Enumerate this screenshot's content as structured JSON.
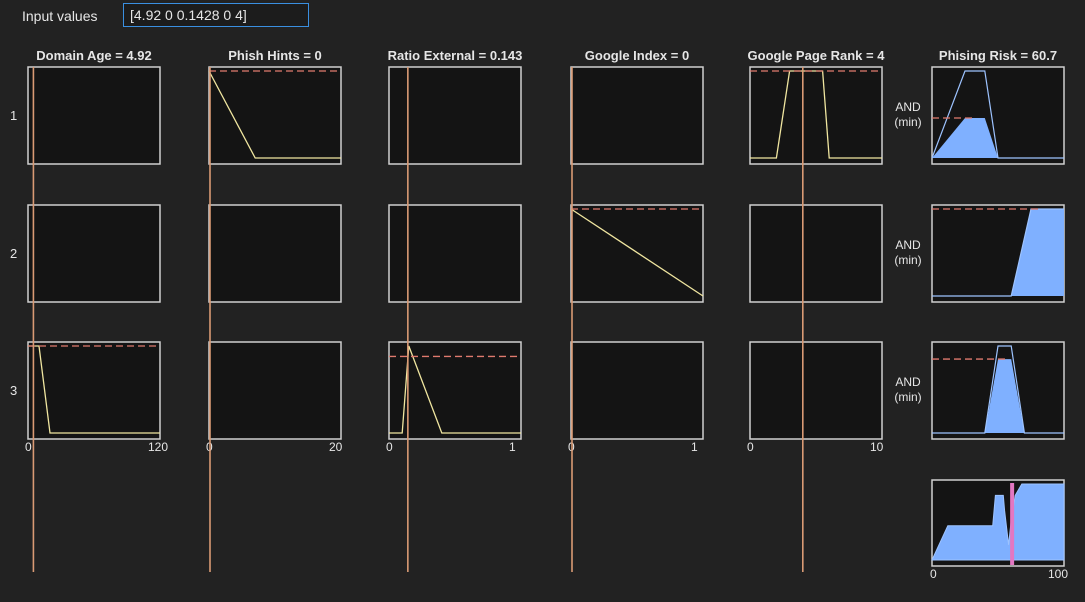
{
  "input": {
    "label": "Input values",
    "value": "[4.92 0 0.1428 0 4]"
  },
  "columns": [
    {
      "title": "Domain Age = 4.92",
      "xmin": 0,
      "xmax": 120,
      "tick_min": "0",
      "tick_max": "120",
      "input": 4.92
    },
    {
      "title": "Phish Hints = 0",
      "xmin": 0,
      "xmax": 20,
      "tick_min": "0",
      "tick_max": "20",
      "input": 0
    },
    {
      "title": "Ratio External = 0.143",
      "xmin": 0,
      "xmax": 1,
      "tick_min": "0",
      "tick_max": "1",
      "input": 0.1428
    },
    {
      "title": "Google Index = 0",
      "xmin": 0,
      "xmax": 1,
      "tick_min": "0",
      "tick_max": "1",
      "input": 0
    },
    {
      "title": "Google Page Rank = 4",
      "xmin": 0,
      "xmax": 10,
      "tick_min": "0",
      "tick_max": "10",
      "input": 4
    }
  ],
  "output": {
    "title": "Phising Risk = 60.7",
    "tick_min": "0",
    "tick_max": "100",
    "xmin": 0,
    "xmax": 100,
    "result": 60.7
  },
  "rows": [
    {
      "label": "1",
      "and_label": "AND",
      "method_label": "(min)"
    },
    {
      "label": "2",
      "and_label": "AND",
      "method_label": "(min)"
    },
    {
      "label": "3",
      "and_label": "AND",
      "method_label": "(min)"
    }
  ],
  "rule_mfs": [
    [
      null,
      [
        [
          0,
          1
        ],
        [
          7,
          0
        ],
        [
          20,
          0
        ]
      ],
      null,
      null,
      [
        [
          0,
          0
        ],
        [
          2,
          0
        ],
        [
          3,
          1
        ],
        [
          5.5,
          1
        ],
        [
          6,
          0
        ],
        [
          10,
          0
        ]
      ]
    ],
    [
      null,
      null,
      null,
      [
        [
          0,
          1
        ],
        [
          1,
          0
        ]
      ],
      null
    ],
    [
      [
        [
          0,
          1
        ],
        [
          10,
          1
        ],
        [
          20,
          0
        ],
        [
          120,
          0
        ]
      ],
      null,
      [
        [
          0,
          0
        ],
        [
          0.1,
          0
        ],
        [
          0.15,
          1
        ],
        [
          0.4,
          0
        ],
        [
          1,
          0
        ]
      ],
      null,
      null
    ]
  ],
  "rule_firing": [
    [
      null,
      1.0,
      null,
      null,
      1.0
    ],
    [
      null,
      null,
      null,
      1.0,
      null
    ],
    [
      1.0,
      null,
      0.88,
      null,
      null
    ]
  ],
  "output_mfs": [
    {
      "shape": [
        [
          0,
          0
        ],
        [
          25,
          1
        ],
        [
          40,
          1
        ],
        [
          50,
          0
        ],
        [
          100,
          0
        ]
      ],
      "strength": 0.46
    },
    {
      "shape": [
        [
          0,
          0
        ],
        [
          60,
          0
        ],
        [
          75,
          1
        ],
        [
          100,
          1
        ]
      ],
      "strength": 1.0
    },
    {
      "shape": [
        [
          0,
          0
        ],
        [
          40,
          0
        ],
        [
          50,
          1
        ],
        [
          60,
          1
        ],
        [
          70,
          0
        ],
        [
          100,
          0
        ]
      ],
      "strength": 0.85
    }
  ],
  "aggregate": [
    [
      0,
      0
    ],
    [
      12,
      0.45
    ],
    [
      46,
      0.45
    ],
    [
      48,
      0.85
    ],
    [
      54,
      0.85
    ],
    [
      55,
      0.65
    ],
    [
      58,
      0.2
    ],
    [
      60,
      0.52
    ],
    [
      63,
      0.85
    ],
    [
      68,
      1
    ],
    [
      100,
      1
    ]
  ],
  "colors": {
    "background": "#222222",
    "axes_bg": "#141414",
    "axes_border": "#d0d0d0",
    "mf_line": "#f0e6a0",
    "input_line": "#d99a74",
    "firing_dash": "#e07a6e",
    "output_fill": "#7fb0ff",
    "output_line": "#9dc3ff",
    "result_line": "#e377c2"
  },
  "icons": {
    "input_field": "text-input"
  }
}
